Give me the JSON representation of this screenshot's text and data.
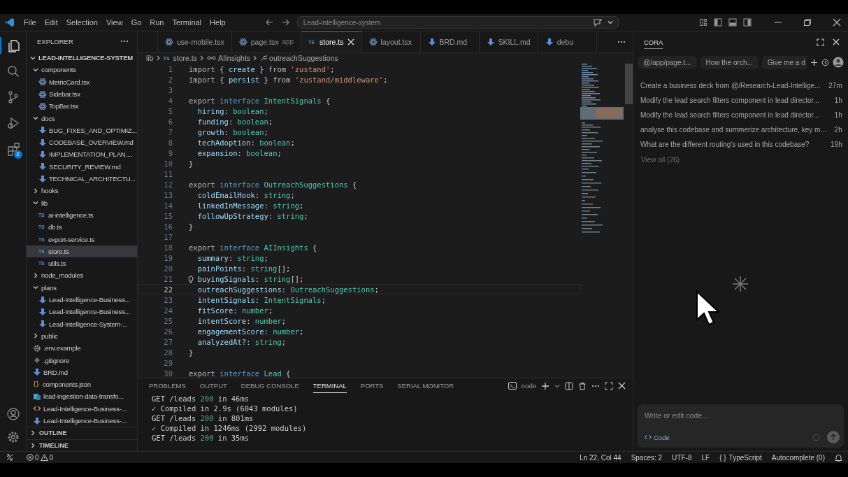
{
  "title_bar": {
    "menus": [
      "File",
      "Edit",
      "Selection",
      "View",
      "Go",
      "Run",
      "Terminal",
      "Help"
    ],
    "command_center": "Lead-intelligence-system"
  },
  "activity_bar": {
    "items": [
      {
        "kind": "explorer",
        "selected": true
      },
      {
        "kind": "search",
        "selected": false
      },
      {
        "kind": "source-control",
        "selected": false
      },
      {
        "kind": "run-debug",
        "selected": false
      },
      {
        "kind": "extensions",
        "selected": false,
        "badge": "2"
      }
    ]
  },
  "explorer": {
    "title": "EXPLORER",
    "root": {
      "label": "LEAD-INTELLIGENCE-SYSTEM",
      "expanded": true
    },
    "tree": [
      {
        "label": "components",
        "kind": "folder",
        "expanded": true,
        "selected": false,
        "children": [
          {
            "label": "MetricCard.tsx",
            "kind": "react",
            "selected": false
          },
          {
            "label": "Sidebar.tsx",
            "kind": "react",
            "selected": false
          },
          {
            "label": "TopBar.tsx",
            "kind": "react",
            "selected": false
          }
        ]
      },
      {
        "label": "docs",
        "kind": "folder",
        "expanded": true,
        "selected": false,
        "children": [
          {
            "label": "BUG_FIXES_AND_OPTIMIZ...",
            "kind": "md",
            "selected": false
          },
          {
            "label": "CODEBASE_OVERVIEW.md",
            "kind": "md",
            "selected": false
          },
          {
            "label": "IMPLEMENTATION_PLAN....",
            "kind": "md",
            "selected": false
          },
          {
            "label": "SECURITY_REVIEW.md",
            "kind": "md",
            "selected": false
          },
          {
            "label": "TECHNICAL_ARCHITECTU...",
            "kind": "md",
            "selected": false
          }
        ]
      },
      {
        "label": "hooks",
        "kind": "folder",
        "expanded": false,
        "selected": false
      },
      {
        "label": "lib",
        "kind": "folder",
        "expanded": true,
        "selected": false,
        "children": [
          {
            "label": "ai-intelligence.ts",
            "kind": "ts",
            "icon_text": "TS",
            "selected": false
          },
          {
            "label": "db.ts",
            "kind": "ts",
            "icon_text": "TS",
            "selected": false
          },
          {
            "label": "export-service.ts",
            "kind": "ts",
            "icon_text": "TS",
            "selected": false
          },
          {
            "label": "store.ts",
            "kind": "ts",
            "icon_text": "TS",
            "selected": true
          },
          {
            "label": "utils.ts",
            "kind": "ts",
            "icon_text": "TS",
            "selected": false
          }
        ]
      },
      {
        "label": "node_modules",
        "kind": "folder",
        "expanded": false,
        "selected": false
      },
      {
        "label": "plans",
        "kind": "folder",
        "expanded": true,
        "selected": false,
        "children": [
          {
            "label": "Lead-Intelligence-Business...",
            "kind": "md",
            "selected": false
          },
          {
            "label": "Lead-Intelligence-Business...",
            "kind": "md",
            "selected": false
          },
          {
            "label": "Lead-Intelligence-System-...",
            "kind": "md",
            "selected": false
          }
        ]
      },
      {
        "label": "public",
        "kind": "folder",
        "expanded": false,
        "selected": false
      },
      {
        "label": ".env.example",
        "kind": "env",
        "selected": false
      },
      {
        "label": ".gitignore",
        "kind": "git",
        "selected": false
      },
      {
        "label": "BRD.md",
        "kind": "md",
        "selected": false
      },
      {
        "label": "components.json",
        "kind": "json",
        "icon_text": "{}",
        "selected": false
      },
      {
        "label": "lead-ingestion-data-transfo...",
        "kind": "sheet",
        "selected": false
      },
      {
        "label": "Lead-Intelligence-Business-...",
        "kind": "html",
        "selected": false
      },
      {
        "label": "Lead-Intelligence-Business-...",
        "kind": "md",
        "selected": false
      }
    ],
    "sections": [
      {
        "label": "OUTLINE",
        "expanded": false
      },
      {
        "label": "TIMELINE",
        "expanded": false
      }
    ]
  },
  "editor": {
    "tabs": [
      {
        "label": "use-mobile.tsx",
        "kind": "react",
        "selected": false
      },
      {
        "label": "page.tsx",
        "description": "app",
        "kind": "react",
        "selected": false
      },
      {
        "label": "store.ts",
        "kind": "ts",
        "icon_text": "TS",
        "selected": true
      },
      {
        "label": "layout.tsx",
        "kind": "react",
        "selected": false
      },
      {
        "label": "BRD.md",
        "kind": "md",
        "selected": false
      },
      {
        "label": "SKILL.md",
        "kind": "md",
        "selected": false
      },
      {
        "label": "debu",
        "kind": "md",
        "selected": false
      }
    ],
    "breadcrumb": [
      {
        "label": "lib",
        "kind": "folder"
      },
      {
        "label": "store.ts",
        "kind": "ts",
        "icon_text": "TS"
      },
      {
        "label": "AIInsights",
        "kind": "interface"
      },
      {
        "label": "outreachSuggestions",
        "kind": "property"
      }
    ],
    "lines": [
      {
        "n": "1",
        "current": false,
        "t": [
          {
            "text": "import",
            "kind": "keyword"
          },
          {
            "text": " { ",
            "kind": "plain"
          },
          {
            "text": "create",
            "kind": "property"
          },
          {
            "text": " } ",
            "kind": "plain"
          },
          {
            "text": "from ",
            "kind": "keyword"
          },
          {
            "text": "'zustand'",
            "kind": "string"
          },
          {
            "text": ";",
            "kind": "plain"
          }
        ]
      },
      {
        "n": "2",
        "current": false,
        "t": [
          {
            "text": "import",
            "kind": "keyword"
          },
          {
            "text": " { ",
            "kind": "plain"
          },
          {
            "text": "persist",
            "kind": "property"
          },
          {
            "text": " } ",
            "kind": "plain"
          },
          {
            "text": "from ",
            "kind": "keyword"
          },
          {
            "text": "'zustand/middleware'",
            "kind": "string"
          },
          {
            "text": ";",
            "kind": "plain"
          }
        ]
      },
      {
        "n": "3",
        "current": false
      },
      {
        "n": "4",
        "current": false,
        "t": [
          {
            "text": "export ",
            "kind": "keyword"
          },
          {
            "text": "interface ",
            "kind": "storage"
          },
          {
            "text": "IntentSignals",
            "kind": "type"
          },
          {
            "text": " {",
            "kind": "plain"
          }
        ]
      },
      {
        "n": "5",
        "current": false,
        "t": [
          {
            "text": "  hiring",
            "kind": "property"
          },
          {
            "text": ": ",
            "kind": "plain"
          },
          {
            "text": "boolean",
            "kind": "type"
          },
          {
            "text": ";",
            "kind": "plain"
          }
        ]
      },
      {
        "n": "6",
        "current": false,
        "t": [
          {
            "text": "  funding",
            "kind": "property"
          },
          {
            "text": ": ",
            "kind": "plain"
          },
          {
            "text": "boolean",
            "kind": "type"
          },
          {
            "text": ";",
            "kind": "plain"
          }
        ]
      },
      {
        "n": "7",
        "current": false,
        "t": [
          {
            "text": "  growth",
            "kind": "property"
          },
          {
            "text": ": ",
            "kind": "plain"
          },
          {
            "text": "boolean",
            "kind": "type"
          },
          {
            "text": ";",
            "kind": "plain"
          }
        ]
      },
      {
        "n": "8",
        "current": false,
        "t": [
          {
            "text": "  techAdoption",
            "kind": "property"
          },
          {
            "text": ": ",
            "kind": "plain"
          },
          {
            "text": "boolean",
            "kind": "type"
          },
          {
            "text": ";",
            "kind": "plain"
          }
        ]
      },
      {
        "n": "9",
        "current": false,
        "t": [
          {
            "text": "  expansion",
            "kind": "property"
          },
          {
            "text": ": ",
            "kind": "plain"
          },
          {
            "text": "boolean",
            "kind": "type"
          },
          {
            "text": ";",
            "kind": "plain"
          }
        ]
      },
      {
        "n": "10",
        "current": false,
        "t": [
          {
            "text": "}",
            "kind": "plain"
          }
        ]
      },
      {
        "n": "11",
        "current": false
      },
      {
        "n": "12",
        "current": false,
        "t": [
          {
            "text": "export ",
            "kind": "keyword"
          },
          {
            "text": "interface ",
            "kind": "storage"
          },
          {
            "text": "OutreachSuggestions",
            "kind": "type"
          },
          {
            "text": " {",
            "kind": "plain"
          }
        ]
      },
      {
        "n": "13",
        "current": false,
        "t": [
          {
            "text": "  coldEmailHook",
            "kind": "property"
          },
          {
            "text": ": ",
            "kind": "plain"
          },
          {
            "text": "string",
            "kind": "type"
          },
          {
            "text": ";",
            "kind": "plain"
          }
        ]
      },
      {
        "n": "14",
        "current": false,
        "t": [
          {
            "text": "  linkedInMessage",
            "kind": "property"
          },
          {
            "text": ": ",
            "kind": "plain"
          },
          {
            "text": "string",
            "kind": "type"
          },
          {
            "text": ";",
            "kind": "plain"
          }
        ]
      },
      {
        "n": "15",
        "current": false,
        "t": [
          {
            "text": "  followUpStrategy",
            "kind": "property"
          },
          {
            "text": ": ",
            "kind": "plain"
          },
          {
            "text": "string",
            "kind": "type"
          },
          {
            "text": ";",
            "kind": "plain"
          }
        ]
      },
      {
        "n": "16",
        "current": false,
        "t": [
          {
            "text": "}",
            "kind": "plain"
          }
        ]
      },
      {
        "n": "17",
        "current": false
      },
      {
        "n": "18",
        "current": false,
        "t": [
          {
            "text": "export ",
            "kind": "keyword"
          },
          {
            "text": "interface ",
            "kind": "storage"
          },
          {
            "text": "AIInsights",
            "kind": "type"
          },
          {
            "text": " {",
            "kind": "plain"
          }
        ]
      },
      {
        "n": "19",
        "current": false,
        "t": [
          {
            "text": "  summary",
            "kind": "property"
          },
          {
            "text": ": ",
            "kind": "plain"
          },
          {
            "text": "string",
            "kind": "type"
          },
          {
            "text": ";",
            "kind": "plain"
          }
        ]
      },
      {
        "n": "20",
        "current": false,
        "t": [
          {
            "text": "  painPoints",
            "kind": "property"
          },
          {
            "text": ": ",
            "kind": "plain"
          },
          {
            "text": "string",
            "kind": "type"
          },
          {
            "text": "[];",
            "kind": "plain"
          }
        ]
      },
      {
        "n": "21",
        "current": false,
        "lightbulb": true,
        "t": [
          {
            "text": "  buyingSignals",
            "kind": "property"
          },
          {
            "text": ": ",
            "kind": "plain"
          },
          {
            "text": "string",
            "kind": "type"
          },
          {
            "text": "[];",
            "kind": "plain"
          }
        ]
      },
      {
        "n": "22",
        "current": true,
        "t": [
          {
            "text": "  outreachSuggestions",
            "kind": "property"
          },
          {
            "text": ": ",
            "kind": "plain"
          },
          {
            "text": "OutreachSuggestions",
            "kind": "type"
          },
          {
            "text": ";",
            "kind": "plain"
          }
        ]
      },
      {
        "n": "23",
        "current": false,
        "t": [
          {
            "text": "  intentSignals",
            "kind": "property"
          },
          {
            "text": ": ",
            "kind": "plain"
          },
          {
            "text": "IntentSignals",
            "kind": "type"
          },
          {
            "text": ";",
            "kind": "plain"
          }
        ]
      },
      {
        "n": "24",
        "current": false,
        "t": [
          {
            "text": "  fitScore",
            "kind": "property"
          },
          {
            "text": ": ",
            "kind": "plain"
          },
          {
            "text": "number",
            "kind": "type"
          },
          {
            "text": ";",
            "kind": "plain"
          }
        ]
      },
      {
        "n": "25",
        "current": false,
        "t": [
          {
            "text": "  intentScore",
            "kind": "property"
          },
          {
            "text": ": ",
            "kind": "plain"
          },
          {
            "text": "number",
            "kind": "type"
          },
          {
            "text": ";",
            "kind": "plain"
          }
        ]
      },
      {
        "n": "26",
        "current": false,
        "t": [
          {
            "text": "  engagementScore",
            "kind": "property"
          },
          {
            "text": ": ",
            "kind": "plain"
          },
          {
            "text": "number",
            "kind": "type"
          },
          {
            "text": ";",
            "kind": "plain"
          }
        ]
      },
      {
        "n": "27",
        "current": false,
        "t": [
          {
            "text": "  analyzedAt?",
            "kind": "property"
          },
          {
            "text": ": ",
            "kind": "plain"
          },
          {
            "text": "string",
            "kind": "type"
          },
          {
            "text": ";",
            "kind": "plain"
          }
        ]
      },
      {
        "n": "28",
        "current": false,
        "t": [
          {
            "text": "}",
            "kind": "plain"
          }
        ]
      },
      {
        "n": "29",
        "current": false
      },
      {
        "n": "30",
        "current": false,
        "t": [
          {
            "text": "export ",
            "kind": "keyword"
          },
          {
            "text": "interface ",
            "kind": "storage"
          },
          {
            "text": "Lead",
            "kind": "type"
          },
          {
            "text": " {",
            "kind": "plain"
          }
        ]
      }
    ]
  },
  "panel": {
    "tabs": [
      {
        "label": "PROBLEMS",
        "selected": false
      },
      {
        "label": "OUTPUT",
        "selected": false
      },
      {
        "label": "DEBUG CONSOLE",
        "selected": false
      },
      {
        "label": "TERMINAL",
        "selected": true
      },
      {
        "label": "PORTS",
        "selected": false
      },
      {
        "label": "SERIAL MONITOR",
        "selected": false
      }
    ],
    "terminal_name": "node",
    "lines": [
      [
        {
          "text": "GET /leads ",
          "kind": "plain"
        },
        {
          "text": "200",
          "kind": "number"
        },
        {
          "text": " in 46ms",
          "kind": "plain"
        }
      ],
      [
        {
          "text": "✓ ",
          "kind": "check"
        },
        {
          "text": "Compiled in 2.9s (6043 modules)",
          "kind": "plain"
        }
      ],
      [
        {
          "text": "GET /leads ",
          "kind": "plain"
        },
        {
          "text": "200",
          "kind": "number"
        },
        {
          "text": " in 801ms",
          "kind": "plain"
        }
      ],
      [
        {
          "text": "✓ ",
          "kind": "check"
        },
        {
          "text": "Compiled in 1246ms (2992 modules)",
          "kind": "plain"
        }
      ],
      [
        {
          "text": "GET /leads ",
          "kind": "plain"
        },
        {
          "text": "200",
          "kind": "number"
        },
        {
          "text": " in 35ms",
          "kind": "plain"
        }
      ]
    ]
  },
  "chat": {
    "title": "CORA",
    "chips": [
      "@/app/page.t...",
      "How the orch...",
      "Give me a d"
    ],
    "history": [
      {
        "text": "Create a business deck from @/Research-Lead-Intellige...",
        "time": "27m"
      },
      {
        "text": "Modify the lead search filters component in lead director...",
        "time": "1h"
      },
      {
        "text": "Modify the lead search filters component in lead director...",
        "time": "1h"
      },
      {
        "text": "analyse this codebase and summerize architecture, key m...",
        "time": "2h"
      },
      {
        "text": "What are the different routing's used in this codebase?",
        "time": "19h"
      }
    ],
    "view_all": "View all (26)",
    "loading": true,
    "input": {
      "placeholder": "Write or edit code...",
      "mode": "Code"
    }
  },
  "status_bar": {
    "errors": "0",
    "warnings": "0",
    "items": [
      "Ln 22, Col 44",
      "Spaces: 2",
      "UTF-8",
      "LF"
    ],
    "language_icon": "{ }",
    "language": "TypeScript",
    "autocomplete": "Autocomplete (0)"
  }
}
